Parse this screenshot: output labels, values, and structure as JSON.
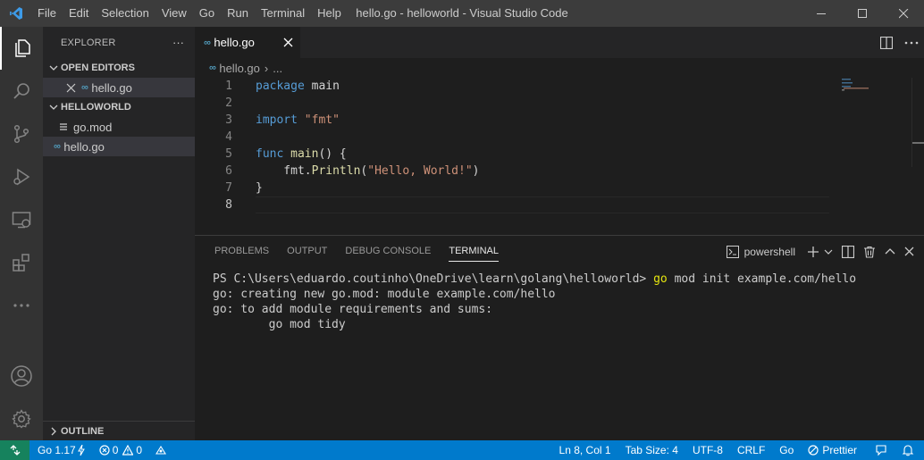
{
  "titlebar": {
    "menu": [
      "File",
      "Edit",
      "Selection",
      "View",
      "Go",
      "Run",
      "Terminal",
      "Help"
    ],
    "title": "hello.go - helloworld - Visual Studio Code"
  },
  "activity_bar": {
    "items": [
      "explorer-icon",
      "search-icon",
      "source-control-icon",
      "run-debug-icon",
      "remote-explorer-icon",
      "extensions-icon",
      "more-icon"
    ],
    "bottom": [
      "accounts-icon",
      "settings-gear-icon"
    ]
  },
  "sidebar": {
    "title": "EXPLORER",
    "more": "···",
    "open_editors": {
      "header": "OPEN EDITORS",
      "items": [
        {
          "glyph": "∞",
          "label": "hello.go"
        }
      ]
    },
    "folder": {
      "header": "HELLOWORLD",
      "files": [
        {
          "glyph": "≡",
          "label": "go.mod"
        },
        {
          "glyph": "∞",
          "label": "hello.go"
        }
      ]
    },
    "outline": "OUTLINE"
  },
  "editor": {
    "tab": {
      "glyph": "∞",
      "label": "hello.go"
    },
    "breadcrumb": {
      "glyph": "∞",
      "file": "hello.go",
      "separator": "›",
      "rest": "..."
    },
    "lines": [
      {
        "n": "1",
        "text": "package main"
      },
      {
        "n": "2",
        "text": ""
      },
      {
        "n": "3",
        "text": "import \"fmt\""
      },
      {
        "n": "4",
        "text": ""
      },
      {
        "n": "5",
        "text": "func main() {"
      },
      {
        "n": "6",
        "text": "    fmt.Println(\"Hello, World!\")"
      },
      {
        "n": "7",
        "text": "}"
      },
      {
        "n": "8",
        "text": ""
      }
    ],
    "active_line": 8
  },
  "panel": {
    "tabs": [
      "PROBLEMS",
      "OUTPUT",
      "DEBUG CONSOLE",
      "TERMINAL"
    ],
    "active_tab": "TERMINAL",
    "shell": "powershell",
    "terminal_lines": [
      {
        "prefix": "PS C:\\Users\\eduardo.coutinho\\OneDrive\\learn\\golang\\helloworld> ",
        "cmd": "go",
        "rest": " mod init example.com/hello"
      },
      {
        "prefix": "go: creating new go.mod: module example.com/hello",
        "cmd": "",
        "rest": ""
      },
      {
        "prefix": "go: to add module requirements and sums:",
        "cmd": "",
        "rest": ""
      },
      {
        "prefix": "        go mod tidy",
        "cmd": "",
        "rest": ""
      }
    ]
  },
  "statusbar": {
    "go_version": "Go 1.17",
    "errors": "0",
    "warnings": "0",
    "position": "Ln 8, Col 1",
    "tab_size": "Tab Size: 4",
    "encoding": "UTF-8",
    "eol": "CRLF",
    "language": "Go",
    "prettier": "Prettier"
  },
  "colors": {
    "accent": "#007acc",
    "remote": "#16825d",
    "keyword": "#569cd6",
    "string": "#ce9178",
    "function": "#dcdcaa",
    "go_icon": "#519aba"
  }
}
